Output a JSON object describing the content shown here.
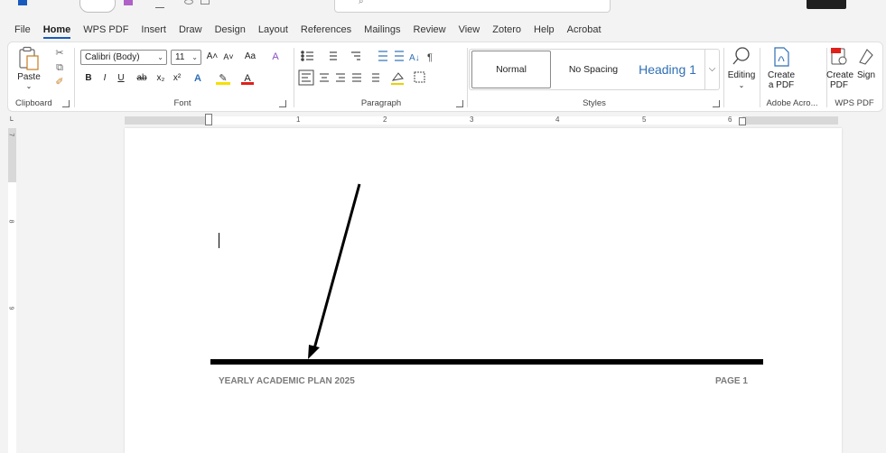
{
  "menu": {
    "tabs": [
      "File",
      "Home",
      "WPS PDF",
      "Insert",
      "Draw",
      "Design",
      "Layout",
      "References",
      "Mailings",
      "Review",
      "View",
      "Zotero",
      "Help",
      "Acrobat"
    ],
    "active": "Home"
  },
  "ribbon": {
    "clipboard": {
      "paste_label": "Paste",
      "group_label": "Clipboard"
    },
    "font": {
      "font_name": "Calibri (Body)",
      "font_size": "11",
      "group_label": "Font",
      "grow": "A˄",
      "shrink": "A˅",
      "change_case": "Aa",
      "bold": "B",
      "italic": "I",
      "underline": "U",
      "strike": "ab",
      "subscript": "x₂",
      "superscript": "x²"
    },
    "paragraph": {
      "group_label": "Paragraph"
    },
    "styles": {
      "group_label": "Styles",
      "items": [
        "Normal",
        "No Spacing",
        "Heading 1"
      ]
    },
    "editing": {
      "label": "Editing"
    },
    "adobe": {
      "create_label_1": "Create",
      "create_label_2": "a PDF",
      "group_label": "Adobe Acro..."
    },
    "wps": {
      "create_label_1": "Create",
      "create_label_2": "PDF",
      "sign_label": "Sign",
      "group_label": "WPS PDF"
    }
  },
  "ruler": {
    "numbers": [
      "1",
      "2",
      "3",
      "4",
      "5",
      "6"
    ]
  },
  "vruler": {
    "numbers": [
      "7",
      "8",
      "9"
    ]
  },
  "document": {
    "footer_left": "YEARLY ACADEMIC PLAN 2025",
    "footer_right": "PAGE 1"
  },
  "colors": {
    "accent": "#185abd",
    "heading": "#2f6fb5"
  }
}
